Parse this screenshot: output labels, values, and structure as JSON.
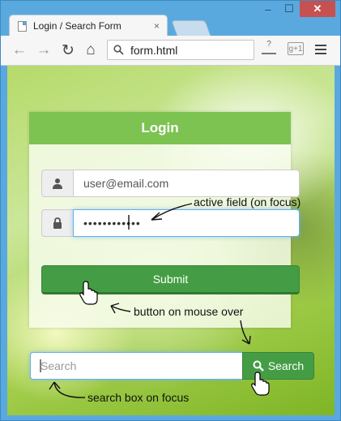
{
  "browser": {
    "tab_title": "Login / Search Form",
    "tab_close": "×",
    "address": "form.html",
    "controls": {
      "minimize": "–",
      "restore": "☐",
      "close": "✕"
    },
    "nav": {
      "back": "←",
      "forward": "→",
      "reload": "↻",
      "home": "⌂"
    },
    "extension_label": "g+1"
  },
  "login": {
    "title": "Login",
    "email_value": "user@email.com",
    "password_value": "••••••••••••",
    "submit_label": "Submit"
  },
  "search": {
    "placeholder": "Search",
    "button_label": "Search"
  },
  "annotations": {
    "active_field": "active field (on focus)",
    "button_hover": "button on mouse over",
    "search_focus": "search box on focus"
  },
  "colors": {
    "header_green": "#7dc352",
    "button_green": "#449d44",
    "focus_blue": "#66afe9"
  }
}
